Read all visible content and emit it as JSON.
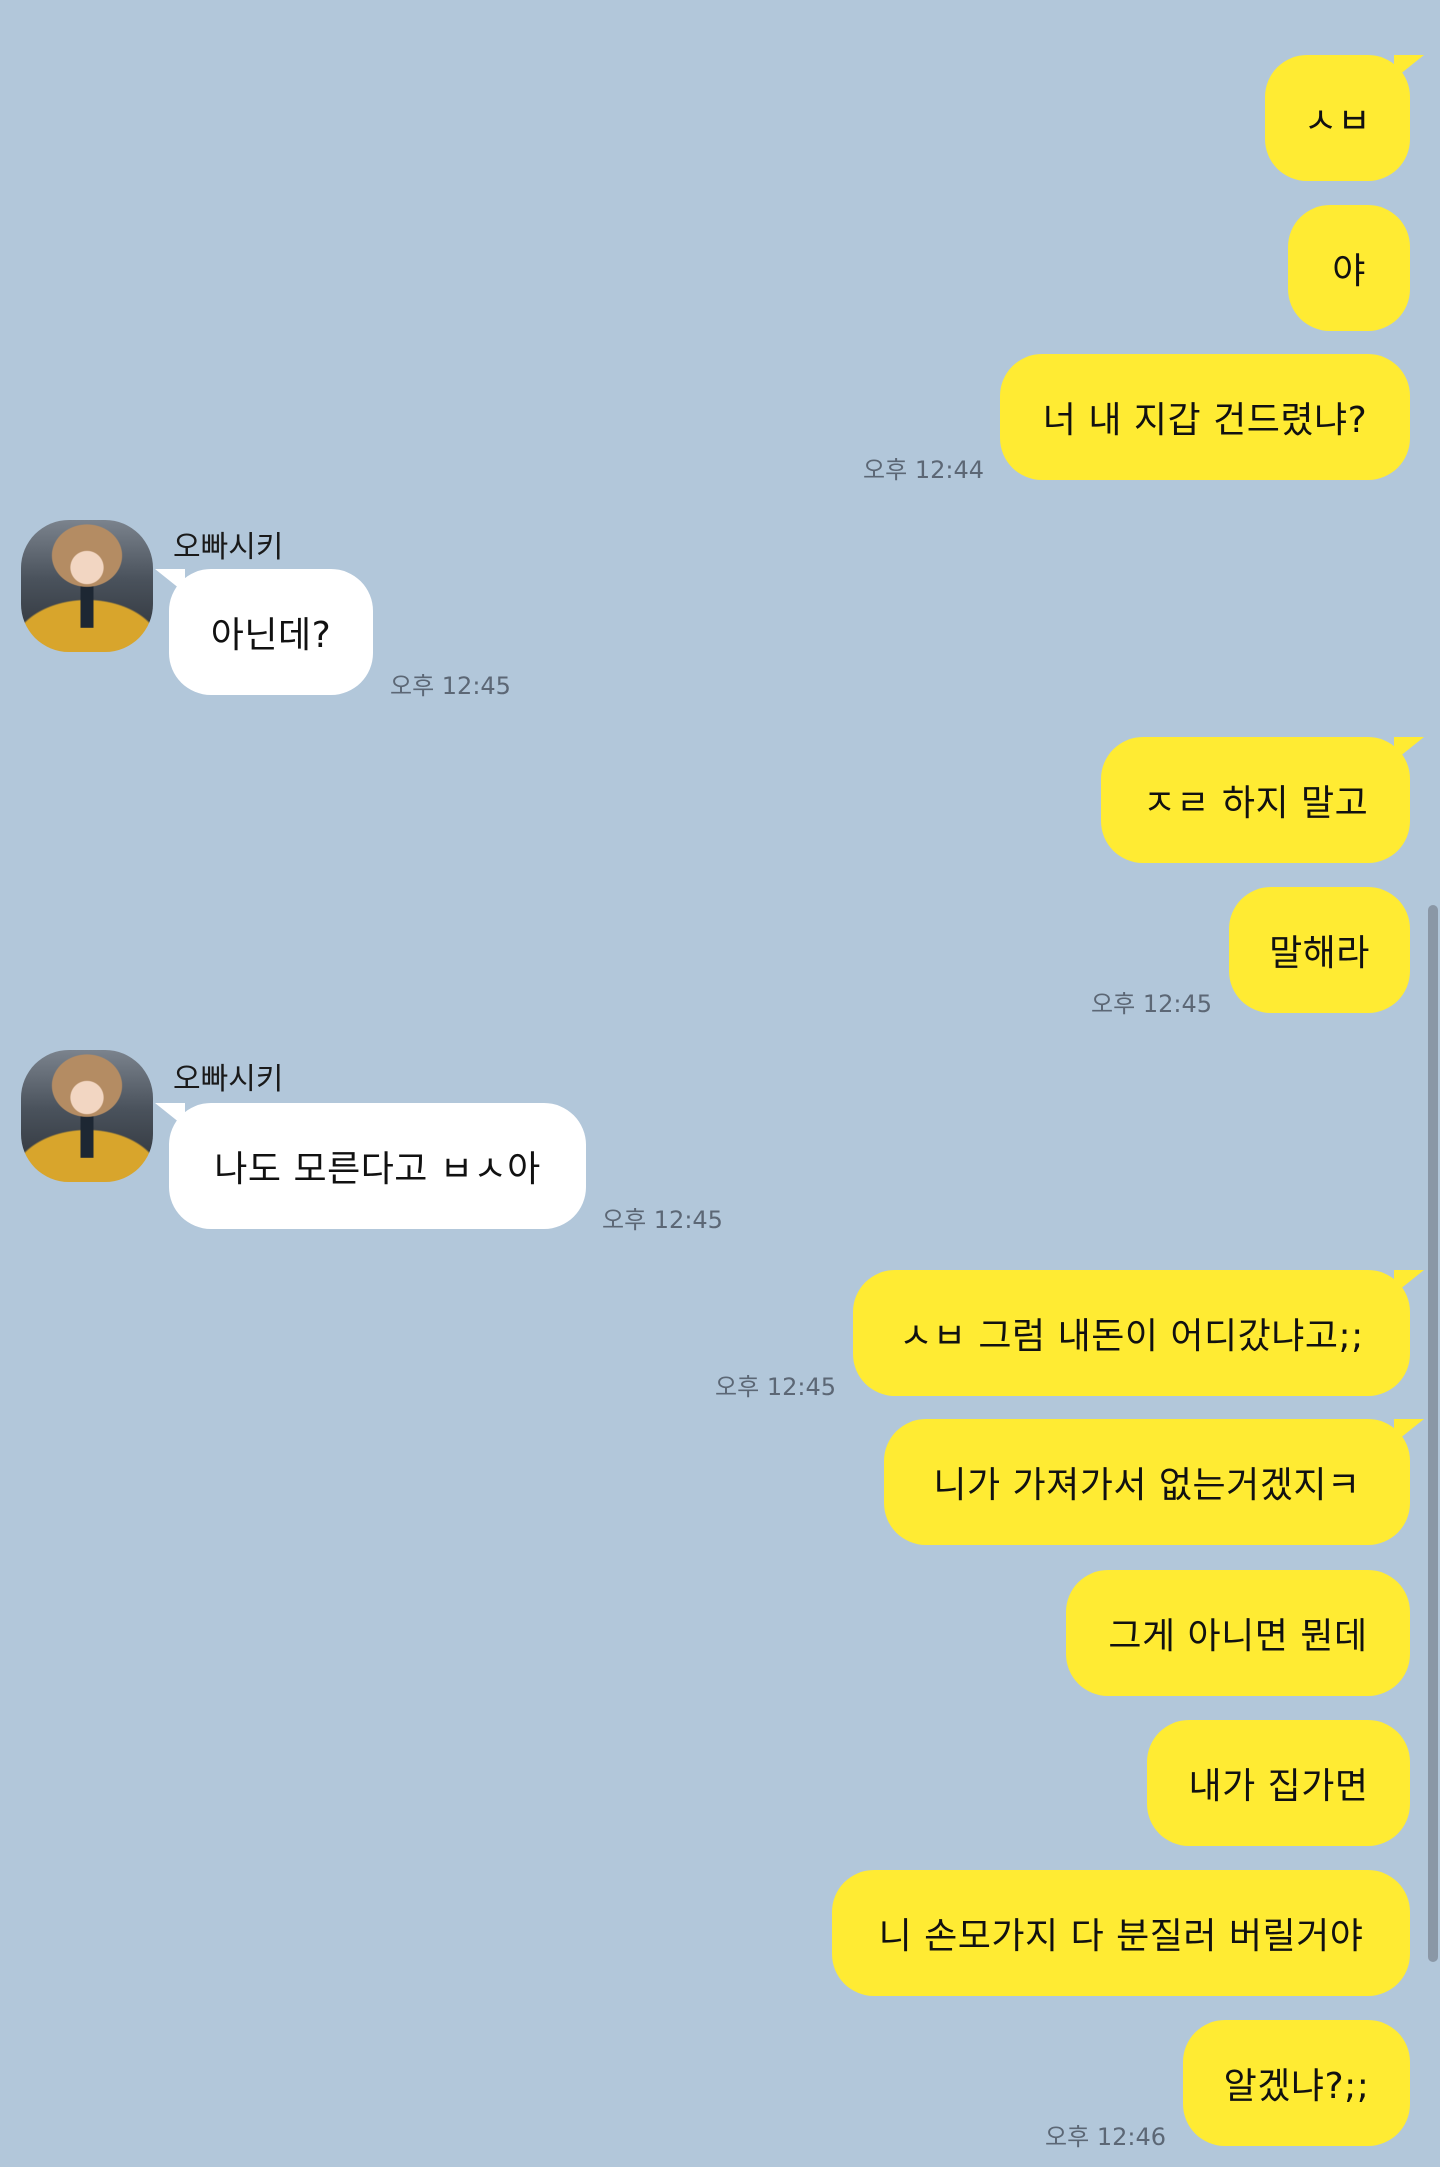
{
  "colors": {
    "background": "#b2c7da",
    "sent_bubble": "#ffeb33",
    "received_bubble": "#ffffff"
  },
  "contact": {
    "avatar_icon": "profile-photo"
  },
  "messages": [
    {
      "sender": "me",
      "text": "ㅅㅂ"
    },
    {
      "sender": "me",
      "text": "야"
    },
    {
      "sender": "me",
      "text": "너 내 지갑 건드렸냐?",
      "time": "오후 12:44"
    },
    {
      "sender": "other",
      "sender_name": "오빠시키",
      "text": "아닌데?",
      "time": "오후 12:45"
    },
    {
      "sender": "me",
      "text": "ㅈㄹ 하지 말고"
    },
    {
      "sender": "me",
      "text": "말해라",
      "time": "오후 12:45"
    },
    {
      "sender": "other",
      "sender_name": "오빠시키",
      "text": "나도 모른다고 ㅂㅅ아",
      "time": "오후 12:45"
    },
    {
      "sender": "me",
      "text": "ㅅㅂ 그럼 내돈이 어디갔냐고;;",
      "time": "오후 12:45"
    },
    {
      "sender": "me",
      "text": "니가 가져가서 없는거겠지ㅋ"
    },
    {
      "sender": "me",
      "text": "그게 아니면 뭔데"
    },
    {
      "sender": "me",
      "text": "내가 집가면"
    },
    {
      "sender": "me",
      "text": "니 손모가지 다 분질러 버릴거야"
    },
    {
      "sender": "me",
      "text": "알겠냐?;;",
      "time": "오후 12:46"
    }
  ]
}
